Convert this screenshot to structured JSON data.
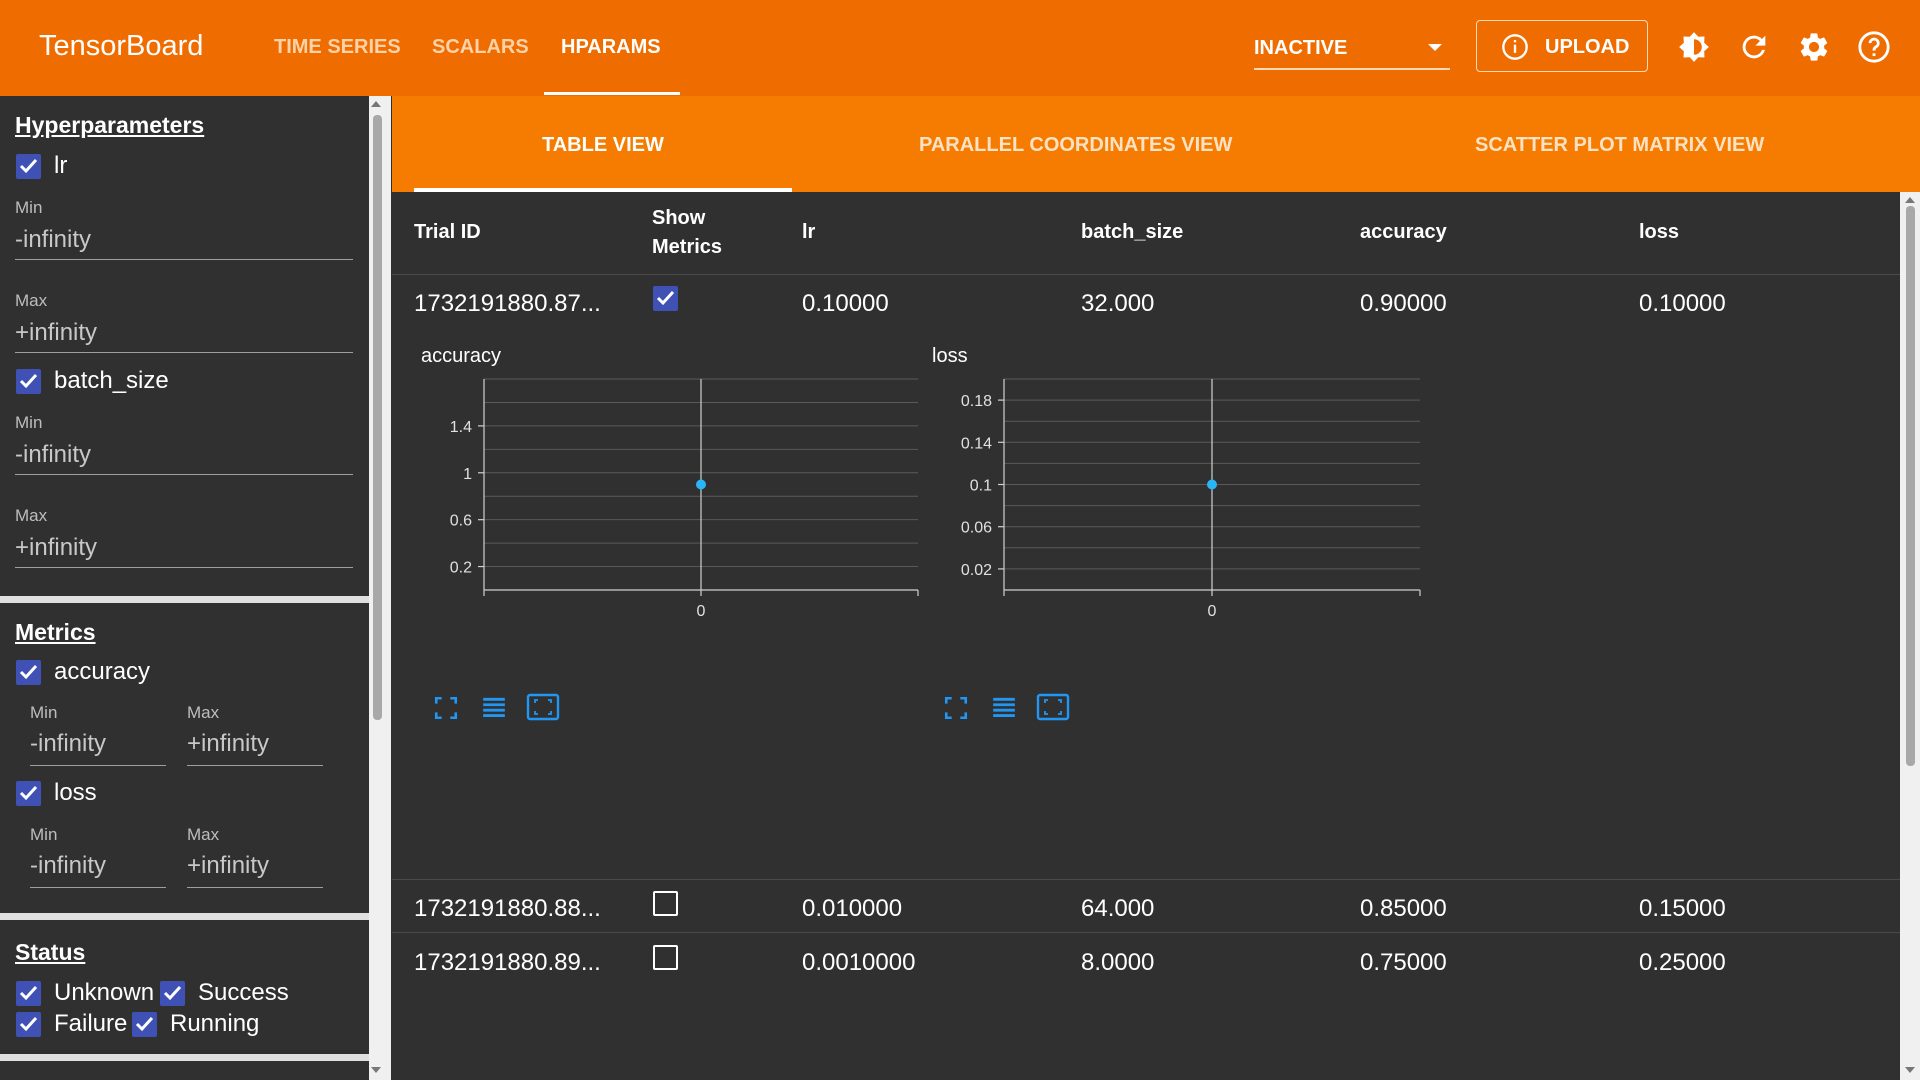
{
  "app": {
    "title": "TensorBoard"
  },
  "nav": {
    "tabs": [
      {
        "label": "TIME SERIES"
      },
      {
        "label": "SCALARS"
      },
      {
        "label": "HPARAMS"
      }
    ],
    "active": "HPARAMS"
  },
  "toolbar": {
    "run_state": "INACTIVE",
    "upload_label": "UPLOAD",
    "icons": [
      "info-icon",
      "theme-toggle-icon",
      "refresh-icon",
      "settings-icon",
      "help-icon"
    ]
  },
  "sidebar": {
    "hparams_title": "Hyperparameters",
    "hparams": [
      {
        "name": "lr",
        "checked": true,
        "min_label": "Min",
        "min": "-infinity",
        "max_label": "Max",
        "max": "+infinity"
      },
      {
        "name": "batch_size",
        "checked": true,
        "min_label": "Min",
        "min": "-infinity",
        "max_label": "Max",
        "max": "+infinity"
      }
    ],
    "metrics_title": "Metrics",
    "metrics": [
      {
        "name": "accuracy",
        "checked": true,
        "min_label": "Min",
        "min": "-infinity",
        "max_label": "Max",
        "max": "+infinity"
      },
      {
        "name": "loss",
        "checked": true,
        "min_label": "Min",
        "min": "-infinity",
        "max_label": "Max",
        "max": "+infinity"
      }
    ],
    "status_title": "Status",
    "statuses": [
      {
        "label": "Unknown",
        "checked": true
      },
      {
        "label": "Success",
        "checked": true
      },
      {
        "label": "Failure",
        "checked": true
      },
      {
        "label": "Running",
        "checked": true
      }
    ]
  },
  "views": {
    "tabs": [
      {
        "label": "TABLE VIEW"
      },
      {
        "label": "PARALLEL COORDINATES VIEW"
      },
      {
        "label": "SCATTER PLOT MATRIX VIEW"
      }
    ],
    "active": "TABLE VIEW"
  },
  "table": {
    "headers": {
      "trial_id": "Trial ID",
      "show_metrics_1": "Show",
      "show_metrics_2": "Metrics",
      "lr": "lr",
      "batch_size": "batch_size",
      "accuracy": "accuracy",
      "loss": "loss"
    },
    "rows": [
      {
        "trial_id": "1732191880.87...",
        "show_metrics": true,
        "lr": "0.10000",
        "batch_size": "32.000",
        "accuracy": "0.90000",
        "loss": "0.10000"
      },
      {
        "trial_id": "1732191880.88...",
        "show_metrics": false,
        "lr": "0.010000",
        "batch_size": "64.000",
        "accuracy": "0.85000",
        "loss": "0.15000"
      },
      {
        "trial_id": "1732191880.89...",
        "show_metrics": false,
        "lr": "0.0010000",
        "batch_size": "8.0000",
        "accuracy": "0.75000",
        "loss": "0.25000"
      }
    ]
  },
  "chart_data": [
    {
      "type": "scatter",
      "title": "accuracy",
      "xlabel": "",
      "ylabel": "",
      "x_ticks": [
        "0"
      ],
      "y_ticks": [
        "0.2",
        "0.6",
        "1",
        "1.4"
      ],
      "xlim": [
        -1,
        1
      ],
      "ylim": [
        0,
        1.8
      ],
      "grid": true,
      "series": [
        {
          "x": [
            0
          ],
          "y": [
            0.9
          ]
        }
      ],
      "color": "#29b6f6"
    },
    {
      "type": "scatter",
      "title": "loss",
      "xlabel": "",
      "ylabel": "",
      "x_ticks": [
        "0"
      ],
      "y_ticks": [
        "0.02",
        "0.06",
        "0.1",
        "0.14",
        "0.18"
      ],
      "xlim": [
        -1,
        1
      ],
      "ylim": [
        0,
        0.2
      ],
      "grid": true,
      "series": [
        {
          "x": [
            0
          ],
          "y": [
            0.1
          ]
        }
      ],
      "color": "#29b6f6"
    }
  ],
  "chart_tools": [
    "fit-domain-icon",
    "log-scale-icon",
    "zoom-selection-icon"
  ],
  "colors": {
    "header": "#ef6c00",
    "subheader": "#f57c00",
    "background": "#303030",
    "checkbox": "#3f51b5",
    "point": "#29b6f6",
    "tool": "#2196f3"
  }
}
